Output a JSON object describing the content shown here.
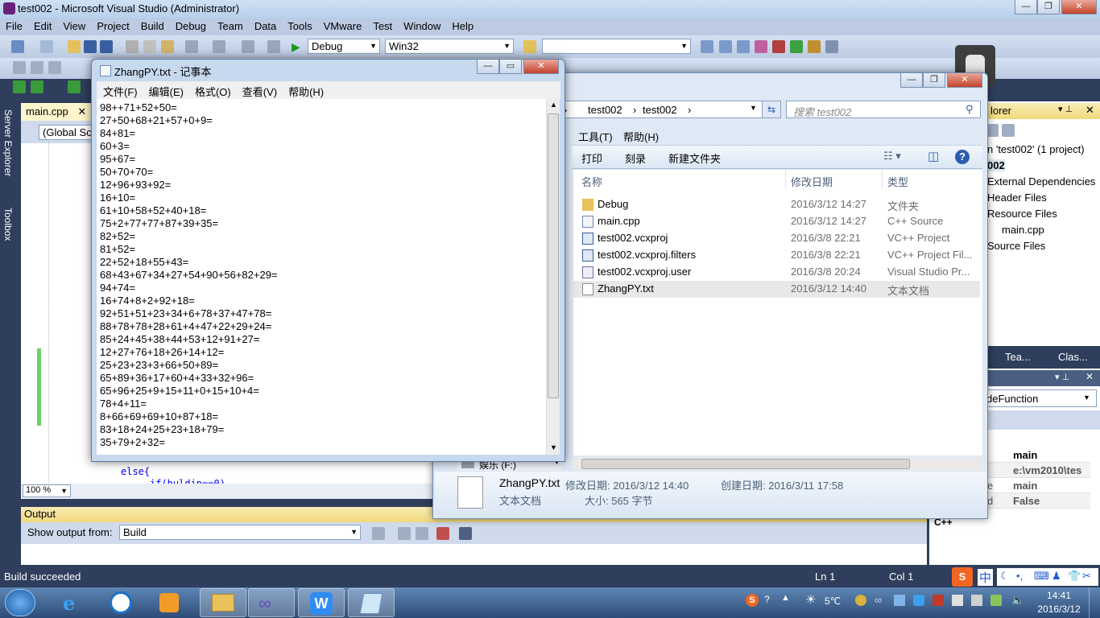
{
  "vs": {
    "title": "test002 - Microsoft Visual Studio (Administrator)",
    "menu": [
      "File",
      "Edit",
      "View",
      "Project",
      "Build",
      "Debug",
      "Team",
      "Data",
      "Tools",
      "VMware",
      "Test",
      "Window",
      "Help"
    ],
    "config": "Debug",
    "platform": "Win32",
    "left_tabs": [
      "Server Explorer",
      "Toolbox"
    ],
    "doc_tab": "main.cpp",
    "scope": "(Global Sco",
    "code_lines": [
      "else{",
      "if(buldin==0)"
    ],
    "zoom": "100 %",
    "output_title": "Output",
    "show_output_from_label": "Show output from:",
    "show_output_from_value": "Build",
    "status_left": "Build succeeded",
    "status_ln": "Ln 1",
    "status_col": "Col 1",
    "solution": {
      "header": "lorer",
      "items": [
        "n 'test002' (1 project)",
        "002",
        "External Dependencies",
        "Header Files",
        "Resource Files",
        "main.cpp",
        "Source Files"
      ]
    },
    "tool_tabs": [
      "Tea...",
      "Clas..."
    ],
    "props_combo": "deFunction",
    "props": [
      {
        "k": "",
        "v": "main"
      },
      {
        "k": "",
        "v": "e:\\vm2010\\tes"
      },
      {
        "k": "e",
        "v": "main"
      },
      {
        "k": "d",
        "v": "False"
      }
    ],
    "props_footer": "C++"
  },
  "explorer": {
    "address": [
      "test002",
      "test002"
    ],
    "search_placeholder": "搜索 test002",
    "menu": [
      "工具(T)",
      "帮助(H)"
    ],
    "commands": [
      "打印",
      "刻录",
      "新建文件夹"
    ],
    "columns": [
      "名称",
      "修改日期",
      "类型"
    ],
    "files": [
      {
        "name": "Debug",
        "date": "2016/3/12 14:27",
        "type": "文件夹",
        "icon": "folder-icon"
      },
      {
        "name": "main.cpp",
        "date": "2016/3/12 14:27",
        "type": "C++ Source",
        "icon": "cpp-file-icon"
      },
      {
        "name": "test002.vcxproj",
        "date": "2016/3/8 22:21",
        "type": "VC++ Project",
        "icon": "project-file-icon"
      },
      {
        "name": "test002.vcxproj.filters",
        "date": "2016/3/8 22:21",
        "type": "VC++ Project Fil...",
        "icon": "project-file-icon"
      },
      {
        "name": "test002.vcxproj.user",
        "date": "2016/3/8 20:24",
        "type": "Visual Studio Pr...",
        "icon": "user-file-icon"
      },
      {
        "name": "ZhangPY.txt",
        "date": "2016/3/12 14:40",
        "type": "文本文档",
        "icon": "text-file-icon"
      }
    ],
    "drive_label": "娱乐 (F:)",
    "details": {
      "name": "ZhangPY.txt",
      "modified_label": "修改日期: 2016/3/12 14:40",
      "created_label": "创建日期: 2016/3/11 17:58",
      "type": "文本文档",
      "size_label": "大小: 565 字节"
    }
  },
  "notepad": {
    "title": "ZhangPY.txt - 记事本",
    "menu": [
      "文件(F)",
      "编辑(E)",
      "格式(O)",
      "查看(V)",
      "帮助(H)"
    ],
    "lines": [
      "98++71+52+50=",
      "27+50+68+21+57+0+9=",
      "84+81=",
      "60+3=",
      "95+67=",
      "50+70+70=",
      "12+96+93+92=",
      "16+10=",
      "61+10+58+52+40+18=",
      "75+2+77+77+87+39+35=",
      "82+52=",
      "81+52=",
      "22+52+18+55+43=",
      "68+43+67+34+27+54+90+56+82+29=",
      "94+74=",
      "16+74+8+2+92+18=",
      "92+51+51+23+34+6+78+37+47+78=",
      "88+78+78+28+61+4+47+22+29+24=",
      "85+24+45+38+44+53+12+91+27=",
      "12+27+76+18+26+14+12=",
      "25+23+23+3+66+50+89=",
      "65+89+36+17+60+4+33+32+96=",
      "65+96+25+9+15+11+0+15+10+4=",
      "78+4+11=",
      "8+66+69+69+10+87+18=",
      "83+18+24+25+23+18+79=",
      "35+79+2+32="
    ]
  },
  "taskbar": {
    "time": "14:41",
    "date": "2016/3/12",
    "temperature": "5℃",
    "ime": "中"
  }
}
